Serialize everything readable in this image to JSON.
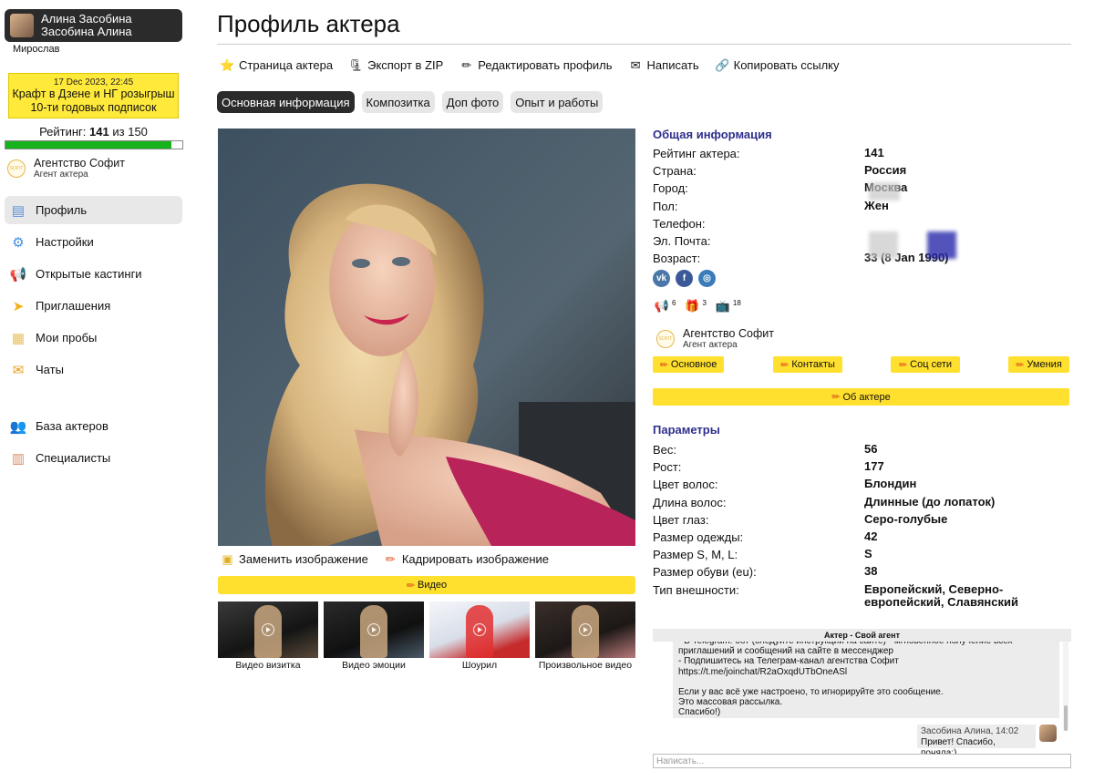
{
  "user": {
    "name_1": "Алина Засобина",
    "name_2": "Засобина Алина",
    "sub": "Мирослав"
  },
  "promo": {
    "date": "17 Dec 2023, 22:45",
    "line1": "Крафт в Дзене и НГ розыгрыш",
    "line2": "10-ти годовых подписок"
  },
  "rating": {
    "label": "Рейтинг:",
    "value": "141",
    "sep": "из",
    "max": "150",
    "fraction": 0.94
  },
  "agency": {
    "logo": "SOFIT",
    "name": "Агентство Софит",
    "role": "Агент актера"
  },
  "nav": [
    {
      "label": "Профиль",
      "icon": "profile-icon",
      "color": "#5a8fd8",
      "glyph": "▤"
    },
    {
      "label": "Настройки",
      "icon": "gear-icon",
      "color": "#3f8fe0",
      "glyph": "⚙"
    },
    {
      "label": "Открытые кастинги",
      "icon": "megaphone-icon",
      "color": "#d43f3f",
      "glyph": "📢"
    },
    {
      "label": "Приглашения",
      "icon": "paper-plane-icon",
      "color": "#f1b21c",
      "glyph": "➤"
    },
    {
      "label": "Мои пробы",
      "icon": "clipboard-icon",
      "color": "#e8c05a",
      "glyph": "▦"
    },
    {
      "label": "Чаты",
      "icon": "chat-icon",
      "color": "#e8a020",
      "glyph": "✉"
    },
    {
      "label": "База актеров",
      "icon": "people-icon",
      "color": "#c0704a",
      "glyph": "👥"
    },
    {
      "label": "Специалисты",
      "icon": "notebook-icon",
      "color": "#d88a60",
      "glyph": "▥"
    }
  ],
  "page": {
    "title": "Профиль актера"
  },
  "toolbar": [
    {
      "label": "Страница актера",
      "icon": "star-icon",
      "glyph": "⭐"
    },
    {
      "label": "Экспорт в ZIP",
      "icon": "zip-icon",
      "glyph": "🗜"
    },
    {
      "label": "Редактировать профиль",
      "icon": "pencil-icon",
      "glyph": "✏"
    },
    {
      "label": "Написать",
      "icon": "message-icon",
      "glyph": "✉"
    },
    {
      "label": "Копировать ссылку",
      "icon": "link-icon",
      "glyph": "🔗"
    }
  ],
  "tabs": [
    "Основная информация",
    "Композитка",
    "Доп фото",
    "Опыт и работы"
  ],
  "photo_actions": {
    "replace": "Заменить изображение",
    "crop": "Кадрировать изображение"
  },
  "video_button": "Видео",
  "videos": [
    "Видео визитка",
    "Видео эмоции",
    "Шоурил",
    "Произвольное видео"
  ],
  "general": {
    "title": "Общая информация",
    "rows": [
      {
        "k": "Рейтинг актера:",
        "v": "141"
      },
      {
        "k": "Страна:",
        "v": "Россия"
      },
      {
        "k": "Город:",
        "v": "Москва"
      },
      {
        "k": "Пол:",
        "v": "Жен"
      },
      {
        "k": "Телефон:",
        "v": ""
      },
      {
        "k": "Эл. Почта:",
        "v": ""
      },
      {
        "k": "Возраст:",
        "v": "33 (8 Jan 1990)"
      }
    ]
  },
  "social": [
    "vk-icon",
    "facebook-icon",
    "instagram-icon"
  ],
  "badges": [
    {
      "icon": "megaphone-icon",
      "count": "6",
      "glyph": "📢"
    },
    {
      "icon": "gift-icon",
      "count": "3",
      "glyph": "🎁"
    },
    {
      "icon": "tv-icon",
      "count": "18",
      "glyph": "📺"
    }
  ],
  "edit_buttons": [
    "Основное",
    "Контакты",
    "Соц сети",
    "Умения"
  ],
  "about_button": "Об актере",
  "params": {
    "title": "Параметры",
    "rows": [
      {
        "k": "Вес:",
        "v": "56"
      },
      {
        "k": "Рост:",
        "v": "177"
      },
      {
        "k": "Цвет волос:",
        "v": "Блондин"
      },
      {
        "k": "Длина волос:",
        "v": "Длинные (до лопаток)"
      },
      {
        "k": "Цвет глаз:",
        "v": "Серо-голубые"
      },
      {
        "k": "Размер одежды:",
        "v": "42"
      },
      {
        "k": "Размер S, M, L:",
        "v": "S"
      },
      {
        "k": "Размер обуви (eu):",
        "v": "38"
      },
      {
        "k": "Тип внешности:",
        "v": "Европейский, Северно-европейский, Славянский"
      }
    ]
  },
  "chat": {
    "header": "Актер - Свой агент",
    "message_lines": [
      "- В Telegram: бот (следуйте инструкции на сайте) - мгновенное получение всех",
      "приглашений и сообщений на сайте в мессенджер",
      "- Подпишитесь на Телеграм-канал агентства Софит",
      "https://t.me/joinchat/R2aOxqdUTbOneASl",
      "",
      "Если у вас всё уже настроено, то игнорируйте это сообщение.",
      "Это массовая рассылка.",
      "Спасибо!)"
    ],
    "reply_meta": "Засобина Алина, 14:02",
    "reply_text": "Привет! Спасибо, поняла:)",
    "input_placeholder": "Написать..."
  }
}
